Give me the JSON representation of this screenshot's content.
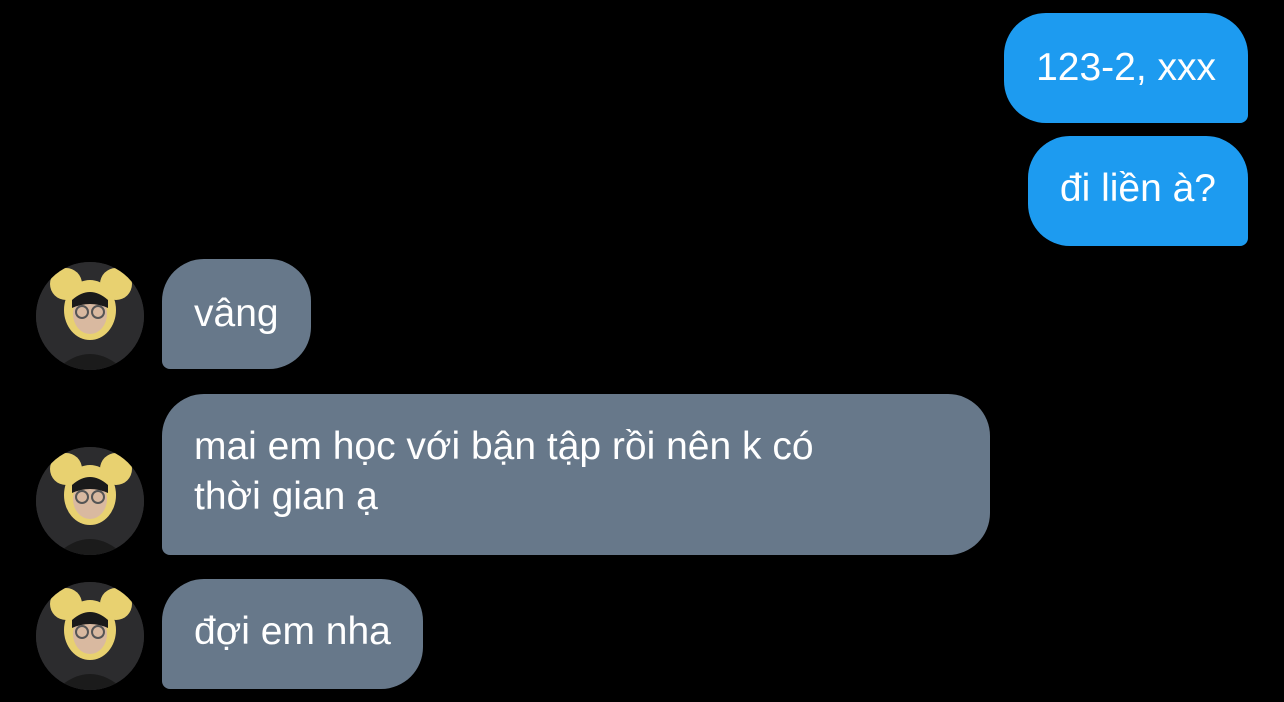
{
  "colors": {
    "background": "#000000",
    "outgoing_bubble": "#1d9bf0",
    "incoming_bubble": "#67788a",
    "text": "#ffffff"
  },
  "messages": [
    {
      "direction": "outgoing",
      "text": "123-2, xxx"
    },
    {
      "direction": "outgoing",
      "text": "đi liền à?"
    },
    {
      "direction": "incoming",
      "text": "vâng",
      "avatar_icon": "user-avatar-icon"
    },
    {
      "direction": "incoming",
      "text": "mai em học với bận tập rồi nên k có",
      "text_line2": "thời gian ạ",
      "avatar_icon": "user-avatar-icon"
    },
    {
      "direction": "incoming",
      "text": "đợi em nha",
      "avatar_icon": "user-avatar-icon"
    }
  ]
}
